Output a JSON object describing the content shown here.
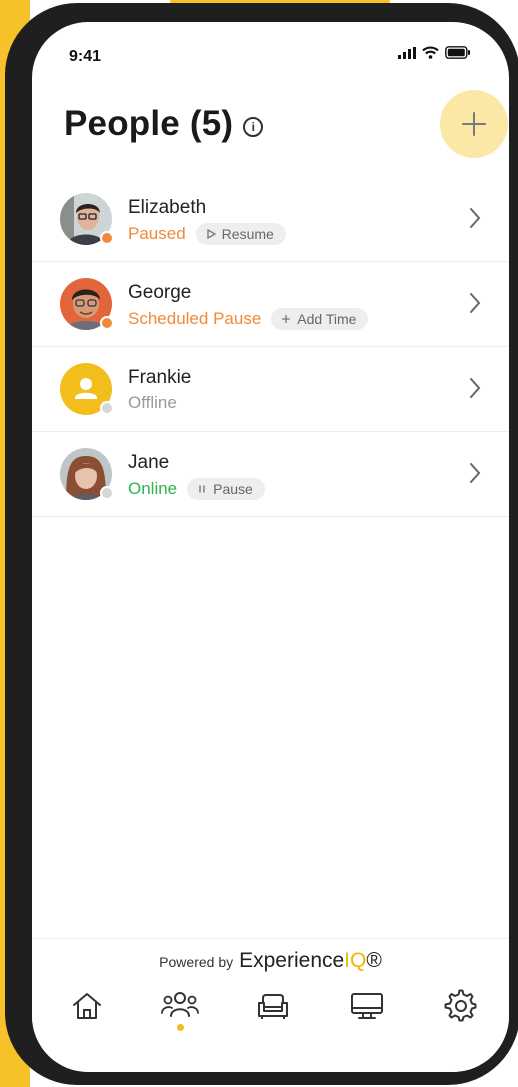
{
  "status_bar": {
    "time": "9:41"
  },
  "header": {
    "title": "People (5)",
    "info_icon": "info-icon",
    "add_icon": "plus-icon"
  },
  "colors": {
    "accent": "#f2be1b",
    "paused": "#f08a3a",
    "online": "#2fb34a",
    "offline": "#9a9a9a"
  },
  "people": [
    {
      "name": "Elizabeth",
      "status": "Paused",
      "status_color": "#f08a3a",
      "presence_color": "#f08a3a",
      "action_icon": "play-icon",
      "action_label": "Resume"
    },
    {
      "name": "George",
      "status": "Scheduled Pause",
      "status_color": "#f08a3a",
      "presence_color": "#f08a3a",
      "action_icon": "plus-icon",
      "action_label": "Add Time"
    },
    {
      "name": "Frankie",
      "status": "Offline",
      "status_color": "#9a9a9a",
      "presence_color": "#d6d6d6"
    },
    {
      "name": "Jane",
      "status": "Online",
      "status_color": "#2fb34a",
      "presence_color": "#d6d6d6",
      "action_icon": "pause-icon",
      "action_label": "Pause"
    }
  ],
  "footer": {
    "powered_by": "Powered by",
    "brand_main": "Experience",
    "brand_accent": "IQ",
    "brand_suffix": "®"
  },
  "tabs": [
    {
      "icon": "home-icon",
      "active": false
    },
    {
      "icon": "people-icon",
      "active": true
    },
    {
      "icon": "sofa-icon",
      "active": false
    },
    {
      "icon": "monitor-icon",
      "active": false
    },
    {
      "icon": "gear-icon",
      "active": false
    }
  ]
}
